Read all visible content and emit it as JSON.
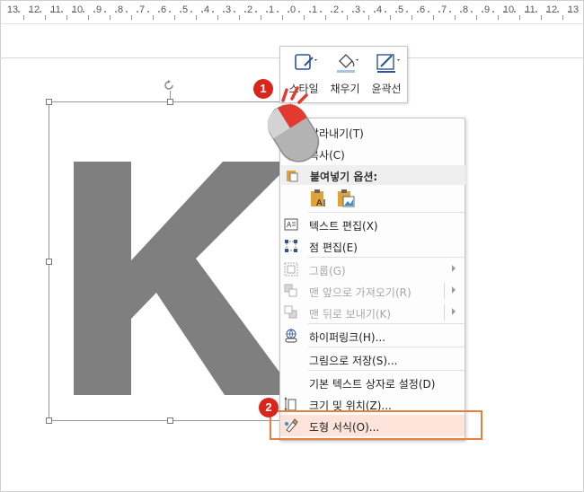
{
  "ruler": {
    "labels": [
      "13",
      "12",
      "11",
      "10",
      "9",
      "8",
      "7",
      "6",
      "5",
      "4",
      "3",
      "2",
      "1",
      "0",
      "1",
      "2",
      "3",
      "4",
      "5",
      "6",
      "7",
      "8",
      "9",
      "10",
      "11",
      "12",
      "13"
    ]
  },
  "slide": {
    "shape_letter": "K",
    "shape_color": "#7f7f7f"
  },
  "mini_toolbar": {
    "style_label": "스타일",
    "fill_label": "채우기",
    "outline_label": "윤곽선"
  },
  "context_menu": {
    "cut": "잘라내기(T)",
    "copy": "복사(C)",
    "paste_options_header": "붙여넣기 옵션:",
    "edit_text": "텍스트 편집(X)",
    "edit_points": "점 편집(E)",
    "group": "그룹(G)",
    "bring_to_front": "맨 앞으로 가져오기(R)",
    "send_to_back": "맨 뒤로 보내기(K)",
    "hyperlink": "하이퍼링크(H)...",
    "save_as_picture": "그림으로 저장(S)...",
    "set_default_textbox": "기본 텍스트 상자로 설정(D)",
    "size_and_position": "크기 및 위치(Z)...",
    "format_shape": "도형 서식(O)..."
  },
  "badges": {
    "step1": "1",
    "step2": "2"
  },
  "colors": {
    "badge": "#d9261c",
    "highlight": "#e97f3b",
    "format_shape_bg": "#fde3d9"
  }
}
